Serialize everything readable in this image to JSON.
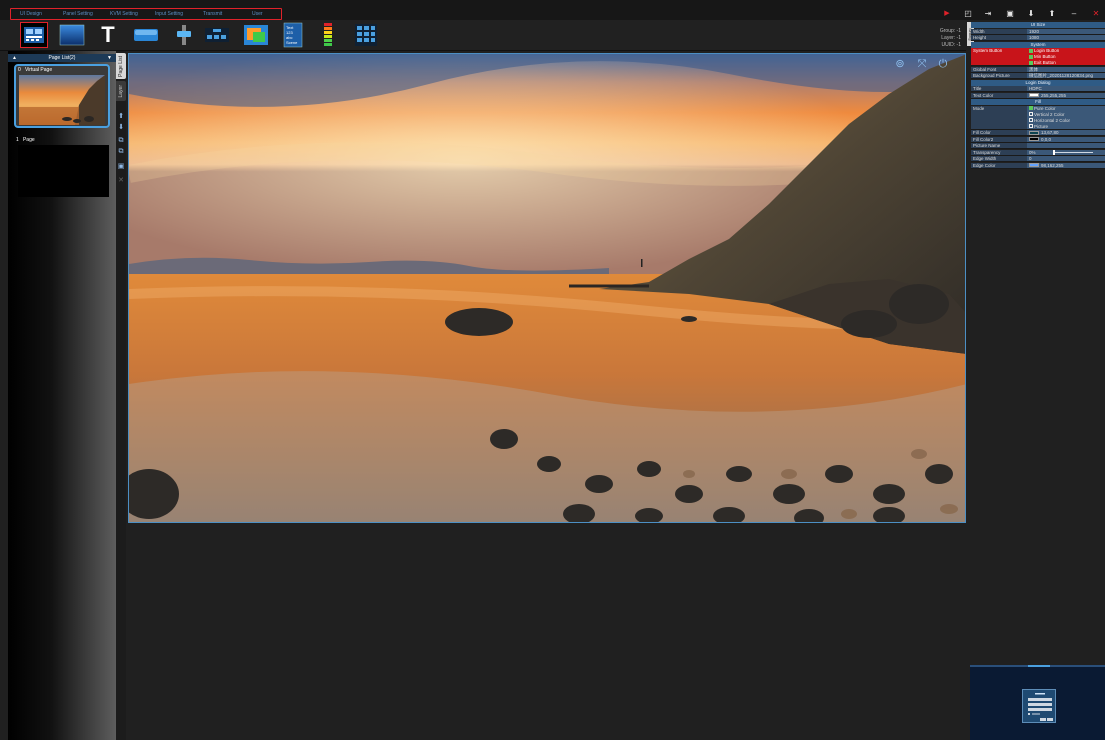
{
  "menu": {
    "items": [
      "UI Design",
      "Panel Setting",
      "KVM Setting",
      "Input Setting",
      "Transmit",
      "User"
    ]
  },
  "window_controls": [
    "play-icon",
    "window-icon",
    "export-icon",
    "save-icon",
    "download-icon",
    "upload-icon",
    "minimize-icon",
    "close-icon"
  ],
  "toolbar": {
    "tools": [
      "layout-icon",
      "blue-panel-icon",
      "text-icon",
      "button-icon",
      "slider-icon",
      "keypad-icon",
      "picture-icon",
      "text-scene-icon",
      "level-meter-icon",
      "grid-icon"
    ],
    "scene_text": "Scene",
    "counters": {
      "group": "Group: -1",
      "layer": "Layer: -1",
      "uuid": "UUID: -1"
    }
  },
  "left_panel": {
    "title": "Page List(2)",
    "pages": [
      {
        "index": "0",
        "name": "Virtual Page"
      },
      {
        "index": "1",
        "name": "Page"
      }
    ]
  },
  "vertical_tabs": {
    "page_list": "Page List",
    "layer": "Layer"
  },
  "canvas": {
    "overlay_icons": [
      "user-icon",
      "shrink-icon",
      "power-icon"
    ]
  },
  "right_panel": {
    "settings_tab": "Setting",
    "sections": [
      {
        "type": "header",
        "label": "UI Size"
      },
      {
        "type": "row",
        "key": "Width",
        "value": "1920"
      },
      {
        "type": "row",
        "key": "Height",
        "value": "1080"
      },
      {
        "type": "header",
        "label": "System"
      },
      {
        "type": "row-red",
        "key": "System Button",
        "values": [
          "Login Button",
          "Min Button",
          "Exit Button"
        ]
      },
      {
        "type": "row",
        "key": "Global Font",
        "value": "黑体"
      },
      {
        "type": "row",
        "key": "Backgroud Picture",
        "value": "微信图片_20201128120834.png"
      },
      {
        "type": "header",
        "label": "Login Dialog"
      },
      {
        "type": "row",
        "key": "Title",
        "value": "HDPC"
      },
      {
        "type": "row-swatch",
        "key": "Text Color",
        "value": "255,255,255",
        "swatch": "#ffffff"
      },
      {
        "type": "header",
        "label": "Fill"
      },
      {
        "type": "row-checks",
        "key": "Mode",
        "values": [
          {
            "label": "Pure Color",
            "checked": true
          },
          {
            "label": "Vertical 2 Color",
            "checked": false
          },
          {
            "label": "Horizontal 2 Color",
            "checked": false
          },
          {
            "label": "Picture",
            "checked": false
          }
        ]
      },
      {
        "type": "row-swatch",
        "key": "Fill Color",
        "value": "13,67,80",
        "swatch": "#0d4350"
      },
      {
        "type": "row-swatch",
        "key": "Fill Color2",
        "value": "0,0,0",
        "swatch": "#000000"
      },
      {
        "type": "row",
        "key": "Picture Name",
        "value": ""
      },
      {
        "type": "row-slider",
        "key": "Transparency",
        "value": "0%",
        "level": 0
      },
      {
        "type": "row",
        "key": "Edge Width",
        "value": "0"
      },
      {
        "type": "row-swatch",
        "key": "Edge Color",
        "value": "98,162,255",
        "swatch": "#62a2ff"
      }
    ]
  },
  "colors": {
    "accent": "#4aa0e0",
    "menu_outline": "#e0222a",
    "menu_text": "#5b8fc6",
    "system_button_bg": "#c8141a",
    "panel_header": "#2f5b85"
  }
}
